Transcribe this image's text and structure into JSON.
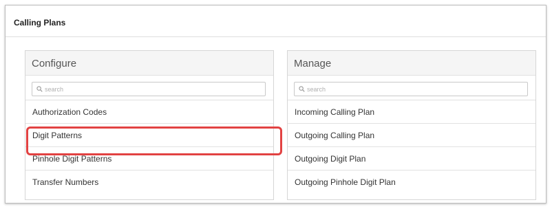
{
  "page": {
    "title": "Calling Plans"
  },
  "configure": {
    "title": "Configure",
    "search_placeholder": "search",
    "items": [
      {
        "label": "Authorization Codes"
      },
      {
        "label": "Digit Patterns"
      },
      {
        "label": "Pinhole Digit Patterns"
      },
      {
        "label": "Transfer Numbers"
      }
    ]
  },
  "manage": {
    "title": "Manage",
    "search_placeholder": "search",
    "items": [
      {
        "label": "Incoming Calling Plan"
      },
      {
        "label": "Outgoing Calling Plan"
      },
      {
        "label": "Outgoing Digit Plan"
      },
      {
        "label": "Outgoing Pinhole Digit Plan"
      }
    ]
  },
  "highlight": {
    "color": "#e24242",
    "target": "Digit Patterns"
  },
  "icons": {
    "search": "search-icon"
  }
}
